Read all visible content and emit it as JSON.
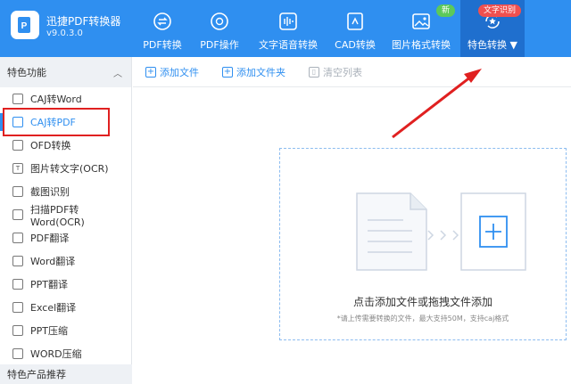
{
  "app": {
    "name": "迅捷PDF转换器",
    "version": "v9.0.3.0"
  },
  "nav": {
    "items": [
      {
        "label": "PDF转换",
        "icon": "exchange-icon"
      },
      {
        "label": "PDF操作",
        "icon": "settings-icon"
      },
      {
        "label": "文字语音转换",
        "icon": "audio-wave-icon"
      },
      {
        "label": "CAD转换",
        "icon": "cad-file-icon"
      },
      {
        "label": "图片格式转换",
        "icon": "image-icon",
        "badge": "新"
      },
      {
        "label": "特色转换",
        "icon": "star-refresh-icon",
        "badge": "文字识别",
        "active": true
      }
    ]
  },
  "sidebar": {
    "header": "特色功能",
    "items": [
      {
        "label": "CAJ转Word"
      },
      {
        "label": "CAJ转PDF",
        "active": true
      },
      {
        "label": "OFD转换"
      },
      {
        "label": "图片转文字(OCR)"
      },
      {
        "label": "截图识别"
      },
      {
        "label": "扫描PDF转Word(OCR)"
      },
      {
        "label": "PDF翻译"
      },
      {
        "label": "Word翻译"
      },
      {
        "label": "PPT翻译"
      },
      {
        "label": "Excel翻译"
      },
      {
        "label": "PPT压缩"
      },
      {
        "label": "WORD压缩"
      }
    ],
    "footer": "特色产品推荐"
  },
  "toolbar": {
    "add_file": "添加文件",
    "add_folder": "添加文件夹",
    "clear_list": "清空列表"
  },
  "dropzone": {
    "title": "点击添加文件或拖拽文件添加",
    "subtitle": "*请上传需要转换的文件，最大支持50M，支持caj格式"
  },
  "colors": {
    "primary": "#2f8ff0",
    "header_active": "#1f6fce",
    "annotation_red": "#e02020"
  }
}
